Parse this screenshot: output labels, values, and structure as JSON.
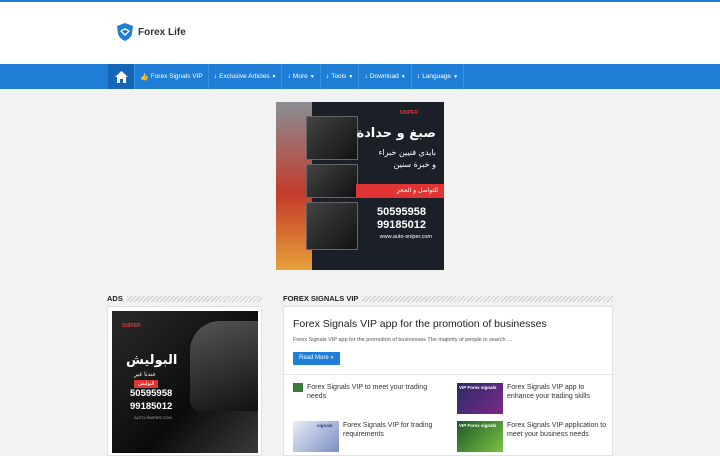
{
  "site": {
    "name": "Forex Life"
  },
  "nav": {
    "items": [
      {
        "label": "Forex Signals VIP",
        "icon": "thumbs-up-icon",
        "caret": false
      },
      {
        "label": "Exclusive Articles",
        "icon": "arrow-down-icon",
        "caret": true
      },
      {
        "label": "More",
        "icon": "arrow-down-icon",
        "caret": true
      },
      {
        "label": "Tools",
        "icon": "arrow-down-icon",
        "caret": true
      },
      {
        "label": "Download",
        "icon": "arrow-down-icon",
        "caret": true
      },
      {
        "label": "Language",
        "icon": "arrow-down-icon",
        "caret": true
      }
    ]
  },
  "top_ad": {
    "brand": "SNIPER",
    "headline": "صبغ و حدادة",
    "sub1": "بايدي فنيين خبراء",
    "sub2": "و خبرة سنين",
    "contact": "للتواصل و الحجز",
    "phone1": "50595958",
    "phone2": "99185012",
    "website": "www.auto-sniper.com"
  },
  "sidebar": {
    "title": "Ads",
    "ad": {
      "brand": "SNIPER",
      "headline": "البوليش",
      "sub": "عندنا غير",
      "tag": "البوليش",
      "phone1": "50595958",
      "phone2": "99185012",
      "website": "AUTO-SNIPER.COM"
    }
  },
  "main": {
    "title": "Forex Signals VIP",
    "featured": {
      "title": "Forex Signals VIP app for the promotion of businesses",
      "excerpt": "Forex Signals VIP app for the promotion of businesses The majority of people in search …",
      "read_more": "Read More »"
    },
    "posts": [
      {
        "title": "Forex Signals VIP to meet your trading needs",
        "thumb_label": ""
      },
      {
        "title": "Forex Signals VIP app to enhance your trading skills",
        "thumb_label": "VIP Forex signals"
      },
      {
        "title": "Forex Signals VIP for trading requirements",
        "thumb_label": "signals"
      },
      {
        "title": "Forex Signals VIP application to meet your business needs",
        "thumb_label": "VIP Forex signals"
      }
    ]
  },
  "colors": {
    "accent": "#1f7fd6",
    "nav_dark": "#1466b8",
    "ad_red": "#e03434"
  }
}
